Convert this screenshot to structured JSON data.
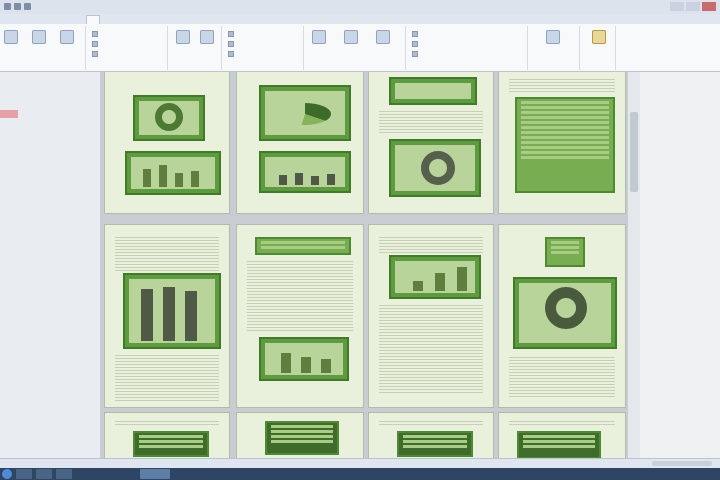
{
  "window": {
    "title": ""
  },
  "tabs": [
    {
      "label": ""
    },
    {
      "label": ""
    },
    {
      "label": ""
    },
    {
      "label": ""
    },
    {
      "label": ""
    },
    {
      "label": ""
    },
    {
      "label": ""
    },
    {
      "label": ""
    }
  ],
  "status": {
    "left": "",
    "right": ""
  },
  "taskbar": {
    "clock": ""
  },
  "colors": {
    "page_bg": "#e9f1dc",
    "accent_green": "#5e9a3e",
    "dark_green": "#3f7b29",
    "ribbon_bg": "#f7f9fb",
    "taskbar": "#2e4563"
  }
}
